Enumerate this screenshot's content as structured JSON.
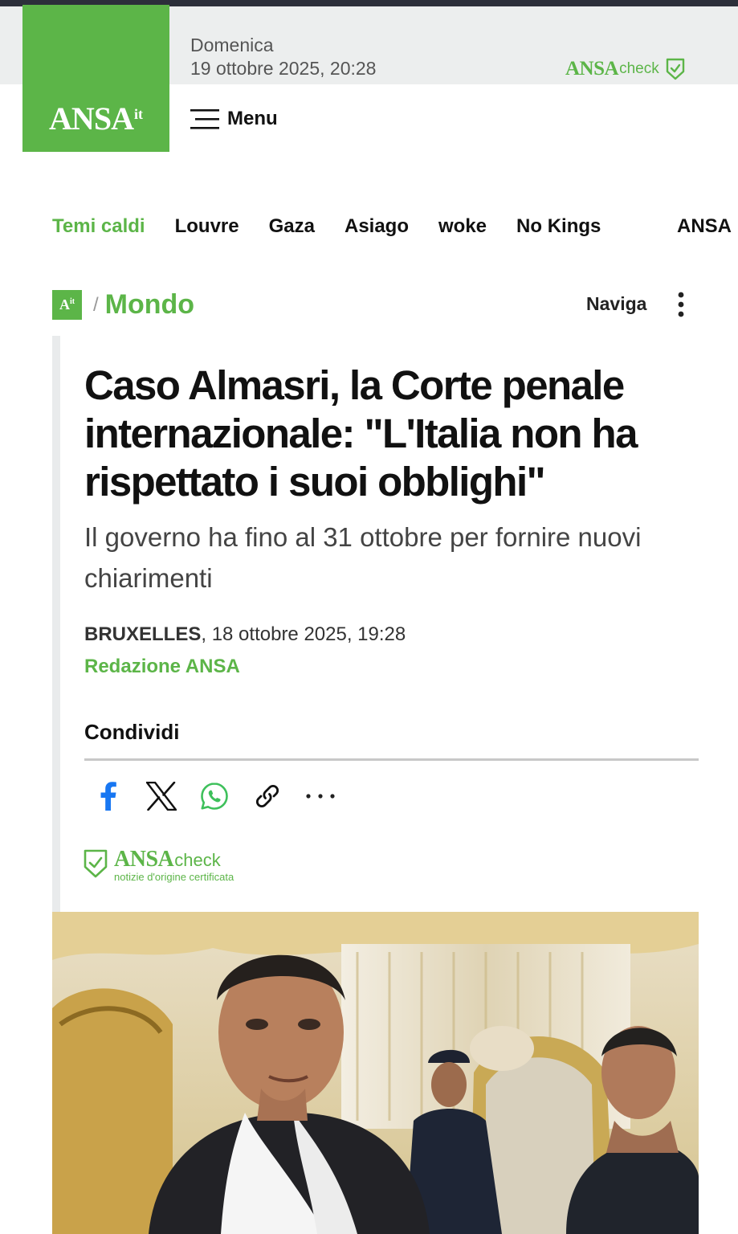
{
  "header": {
    "day": "Domenica",
    "datetime": "19 ottobre 2025, 20:28",
    "logo_main": "ANSA",
    "logo_sup": "it",
    "check_brand": "ANSA",
    "check_word": "check",
    "menu_label": "Menu",
    "brand_green": "#5cb548"
  },
  "topics": [
    {
      "label": "Temi caldi"
    },
    {
      "label": "Louvre"
    },
    {
      "label": "Gaza"
    },
    {
      "label": "Asiago"
    },
    {
      "label": "woke"
    },
    {
      "label": "No Kings"
    }
  ],
  "topic_extra": "ANSA",
  "breadcrumb": {
    "logo": "A",
    "logo_sup": "it",
    "separator": "/",
    "section": "Mondo",
    "naviga": "Naviga"
  },
  "article": {
    "title": "Caso Almasri, la Corte penale internazionale: \"L'Italia non ha rispettato i suoi obblighi\"",
    "subtitle": "Il governo ha fino al 31 ottobre per fornire nuovi chiarimenti",
    "place": "BRUXELLES",
    "date": ", 18 ottobre 2025, 19:28",
    "author": "Redazione ANSA"
  },
  "share": {
    "label": "Condividi",
    "icons": [
      "facebook-icon",
      "x-icon",
      "whatsapp-icon",
      "link-icon",
      "more-icon"
    ]
  },
  "badge": {
    "brand": "ANSA",
    "word": "check",
    "sub": "notizie d'origine certificata"
  }
}
